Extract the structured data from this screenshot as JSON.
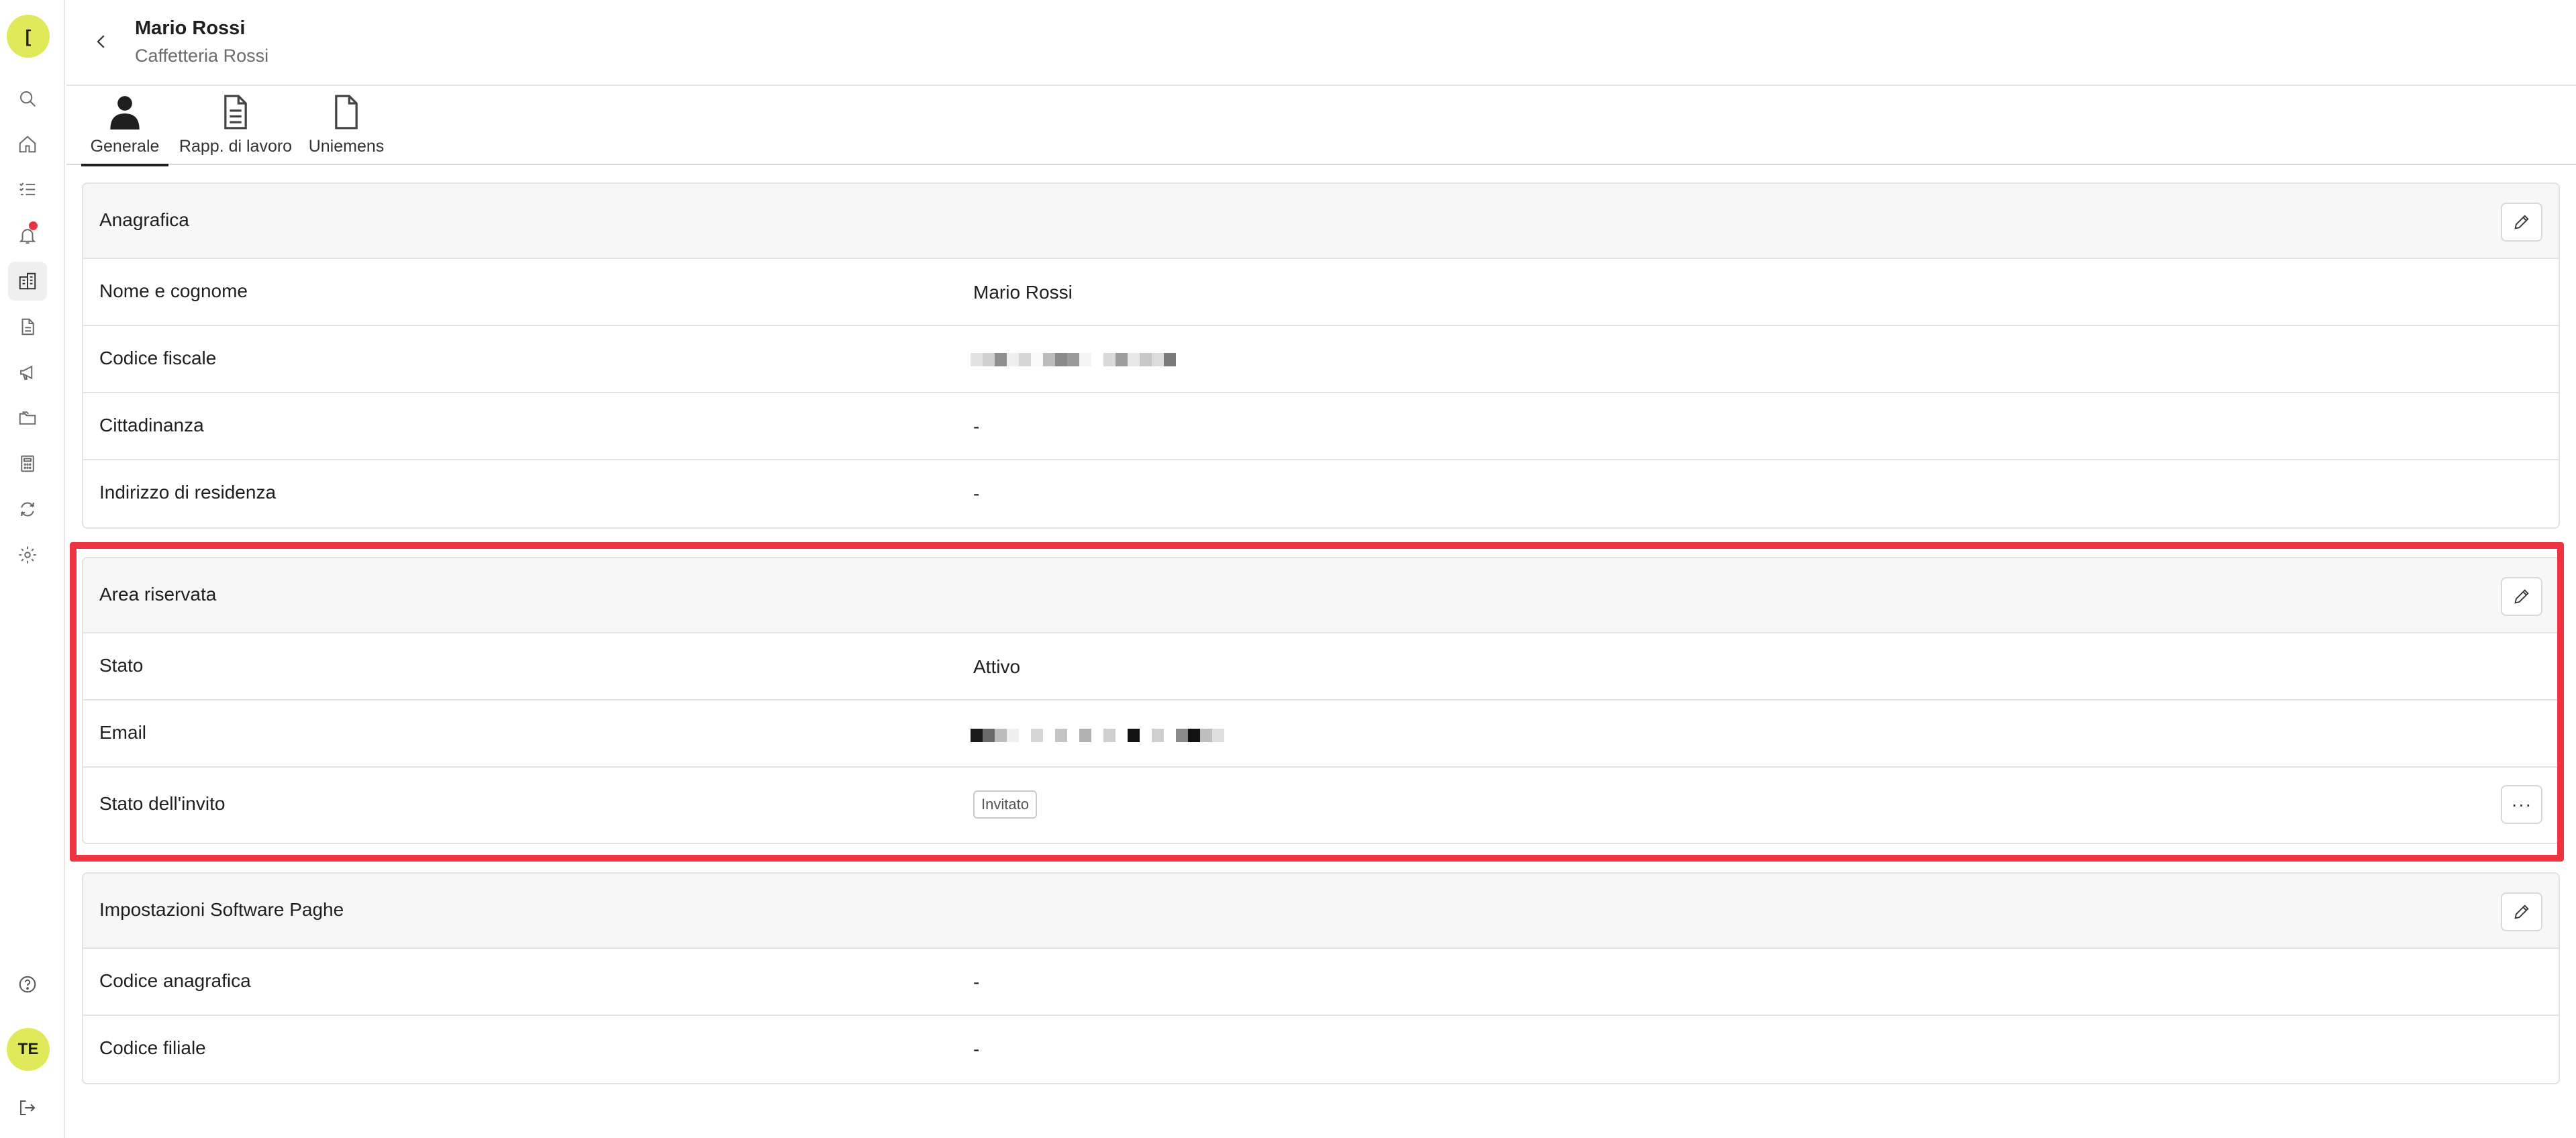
{
  "rail": {
    "top_avatar": "[",
    "bottom_avatar": "TE",
    "icons": [
      "search-icon",
      "home-icon",
      "tasks-icon",
      "bell-icon",
      "building-icon",
      "document-icon",
      "megaphone-icon",
      "folders-icon",
      "calculator-icon",
      "sync-icon",
      "gear-icon",
      "help-icon",
      "logout-icon"
    ]
  },
  "header": {
    "name": "Mario Rossi",
    "company": "Caffetteria Rossi"
  },
  "tabs": [
    {
      "label": "Generale",
      "icon": "person-icon",
      "active": true
    },
    {
      "label": "Rapp. di lavoro",
      "icon": "document-lines-icon"
    },
    {
      "label": "Uniemens",
      "icon": "document-icon"
    }
  ],
  "anagrafica": {
    "title": "Anagrafica",
    "rows": [
      {
        "label": "Nome e cognome",
        "value": "Mario Rossi"
      },
      {
        "label": "Codice fiscale",
        "value": ""
      },
      {
        "label": "Cittadinanza",
        "value": "-"
      },
      {
        "label": "Indirizzo di residenza",
        "value": "-"
      }
    ]
  },
  "area_riservata": {
    "title": "Area riservata",
    "rows": [
      {
        "label": "Stato",
        "value": "Attivo"
      },
      {
        "label": "Email",
        "value": ""
      },
      {
        "label": "Stato dell'invito",
        "value": "Invitato",
        "more": "···"
      }
    ]
  },
  "software_paghe": {
    "title": "Impostazioni Software Paghe",
    "rows": [
      {
        "label": "Codice anagrafica",
        "value": "-"
      },
      {
        "label": "Codice filiale",
        "value": "-"
      }
    ]
  },
  "colors": {
    "accent_yellow": "#dfe95a",
    "highlight_red": "#ef3340",
    "notification_red": "#e33340"
  }
}
